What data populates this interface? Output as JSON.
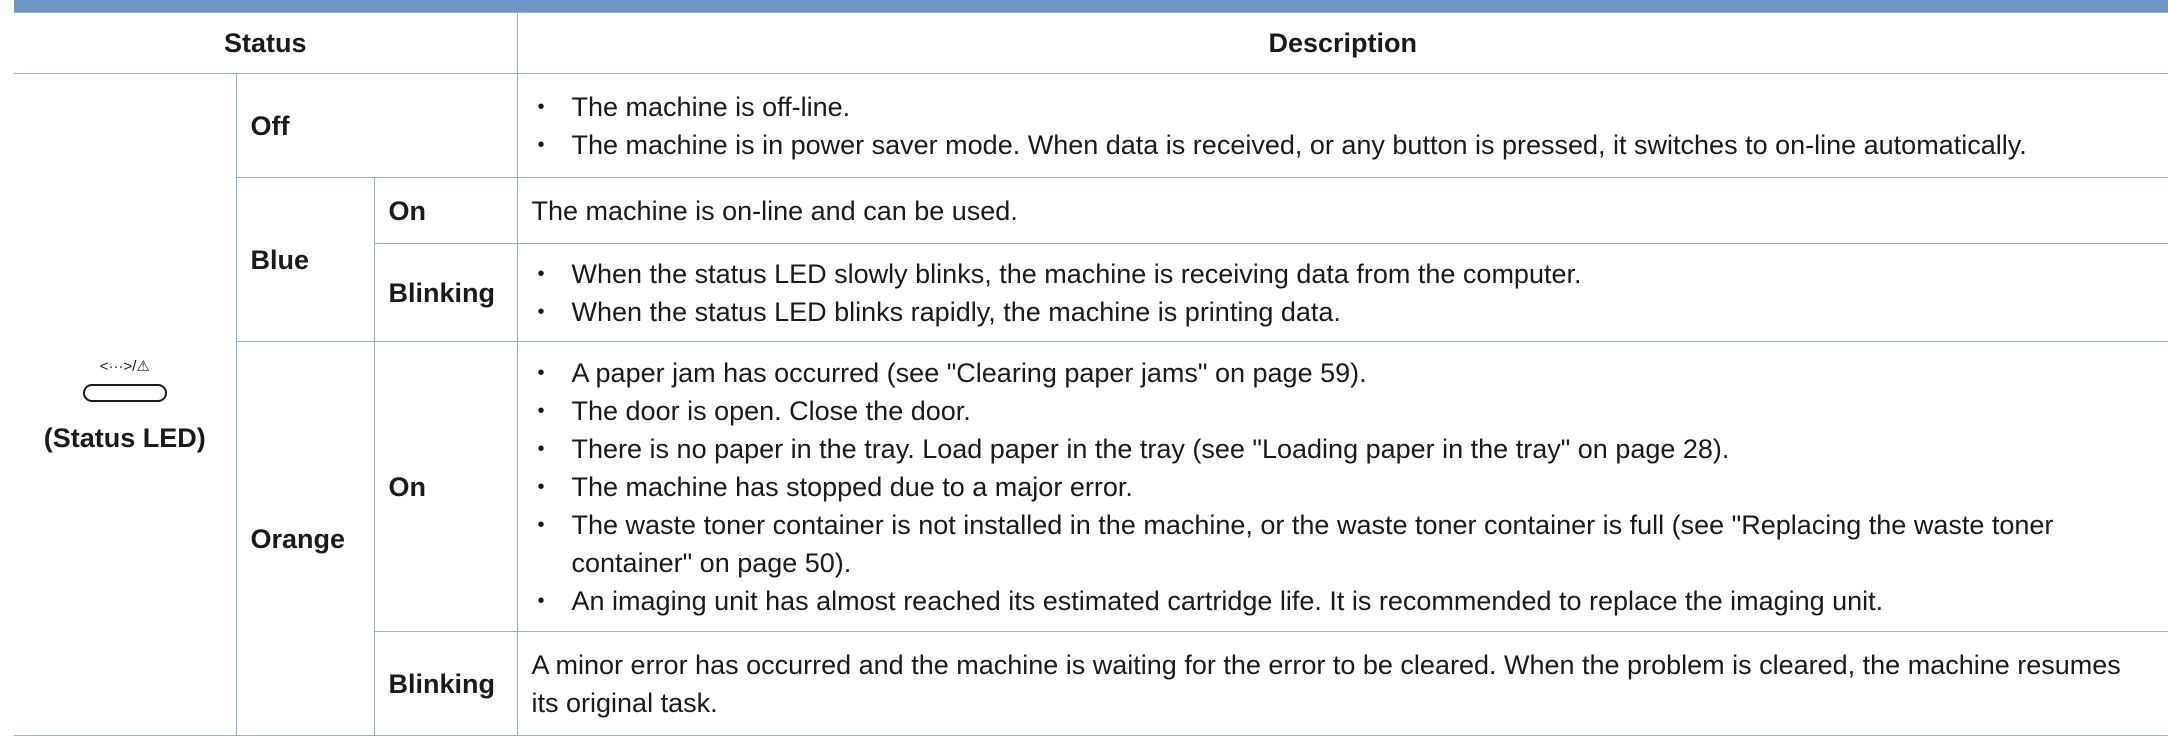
{
  "header": {
    "status": "Status",
    "description": "Description"
  },
  "status_led": {
    "icon_caption": "<···>/⚠",
    "label": "(Status LED)"
  },
  "rows": {
    "off": {
      "label": "Off",
      "items": [
        "The machine is off-line.",
        "The machine is in power saver mode. When data is received, or any button is pressed, it switches to on-line automatically."
      ]
    },
    "blue": {
      "label": "Blue",
      "on": {
        "label": "On",
        "text": "The machine is on-line and can be used."
      },
      "blinking": {
        "label": "Blinking",
        "items": [
          "When the status LED slowly blinks, the machine is receiving data from the computer.",
          "When the status LED blinks rapidly, the machine is printing data."
        ]
      }
    },
    "orange": {
      "label": "Orange",
      "on": {
        "label": "On",
        "items": [
          "A paper jam has occurred (see \"Clearing paper jams\" on page 59).",
          "The door is open. Close the door.",
          "There is no paper in the tray. Load paper in the tray (see \"Loading paper in the tray\" on page 28).",
          "The machine has stopped due to a major error.",
          "The waste toner container is not installed in the machine, or the waste toner container is full (see \"Replacing the waste toner container\" on page 50).",
          "An imaging unit has almost reached its estimated cartridge life. It is recommended to replace the imaging unit."
        ]
      },
      "blinking": {
        "label": "Blinking",
        "text": "A minor error has occurred and the machine is waiting for the error to be cleared. When the problem is cleared, the machine resumes its original task."
      }
    }
  },
  "colors": {
    "top_bar": "#6f95c4",
    "grid_line": "#8eb1d8"
  }
}
